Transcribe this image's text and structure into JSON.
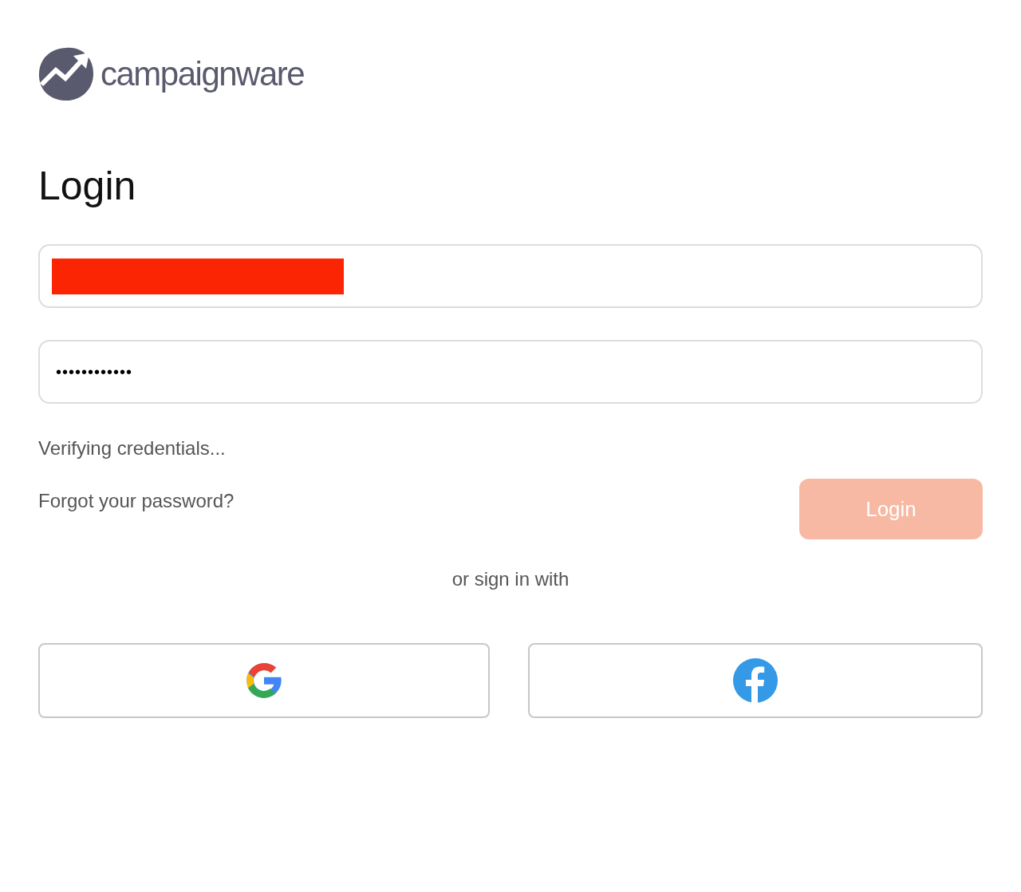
{
  "brand": {
    "name": "campaignware"
  },
  "heading": "Login",
  "email_field": {
    "redacted": true
  },
  "password_field": {
    "value": "••••••••••••"
  },
  "status_message": "Verifying credentials...",
  "forgot_link": "Forgot your password?",
  "login_button": {
    "label": "Login",
    "disabled": true
  },
  "divider_text": "or sign in with",
  "social_buttons": [
    {
      "kind": "google"
    },
    {
      "kind": "facebook"
    }
  ]
}
